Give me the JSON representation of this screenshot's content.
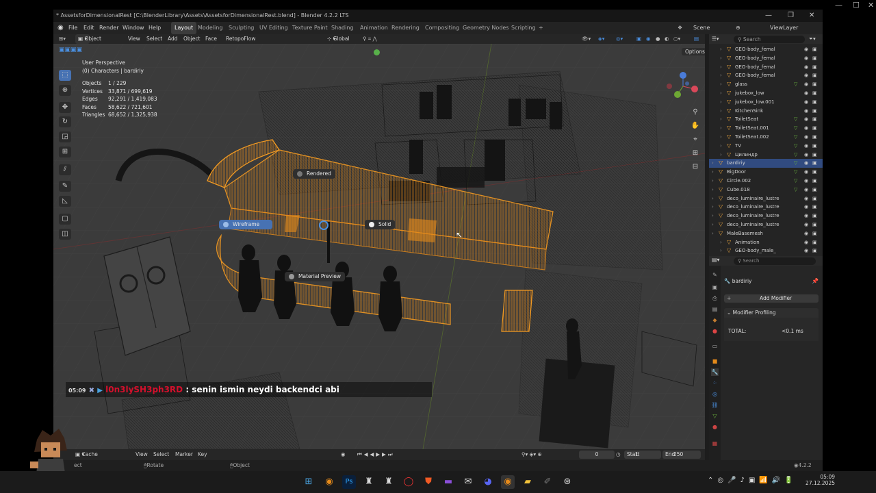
{
  "window": {
    "title": "* AssetsforDimensionalRest [C:\\BlenderLibrary\\Assets\\AssetsforDimensionalRest.blend] - Blender 4.2.2 LTS"
  },
  "menu": {
    "items": [
      "File",
      "Edit",
      "Render",
      "Window",
      "Help"
    ],
    "workspaces": [
      "Layout",
      "Modeling",
      "Sculpting",
      "UV Editing",
      "Texture Paint",
      "Shading",
      "Animation",
      "Rendering",
      "Compositing",
      "Geometry Nodes",
      "Scripting"
    ],
    "add_tab": "+",
    "scene": "Scene",
    "view_layer": "ViewLayer"
  },
  "viewport_header": {
    "mode": "Object Mode",
    "items": [
      "View",
      "Select",
      "Add",
      "Object",
      "Face",
      "RetopoFlow"
    ],
    "orientation": "Global",
    "options": "Options"
  },
  "overlay": {
    "perspective": "User Perspective",
    "collection": "(0) Characters | bardiriy",
    "stats": [
      {
        "k": "Objects",
        "v": "1 / 229"
      },
      {
        "k": "Vertices",
        "v": "33,871 / 699,619"
      },
      {
        "k": "Edges",
        "v": "92,291 / 1,419,083"
      },
      {
        "k": "Faces",
        "v": "58,622 / 721,601"
      },
      {
        "k": "Triangles",
        "v": "68,652 / 1,325,938"
      }
    ]
  },
  "pie": {
    "rendered": "Rendered",
    "wireframe": "Wireframe",
    "solid": "Solid",
    "material": "Material Preview"
  },
  "chat": {
    "time": "05:09",
    "user": "l0n3lySH3ph3RD",
    "sep": " : ",
    "message": "senin ismin neydi backendci abi"
  },
  "timeline": {
    "items": [
      "Cache File",
      "View",
      "Select",
      "Marker",
      "Key"
    ],
    "frame": "0",
    "start_label": "Start",
    "start": "1",
    "end_label": "End",
    "end": "250"
  },
  "status": {
    "left": "ect",
    "middle": "Rotate View",
    "right": "Object",
    "version": "4.2.2"
  },
  "outliner": {
    "search": "Search",
    "rows": [
      {
        "name": "GEO-body_femal",
        "ind": 1,
        "mat": false
      },
      {
        "name": "GEO-body_femal",
        "ind": 1,
        "mat": false
      },
      {
        "name": "GEO-body_femal",
        "ind": 1,
        "mat": false
      },
      {
        "name": "GEO-body_femal",
        "ind": 1,
        "mat": false
      },
      {
        "name": "glass",
        "ind": 1,
        "mat": true
      },
      {
        "name": "jukebox_low",
        "ind": 1,
        "mat": false
      },
      {
        "name": "jukebox_low.001",
        "ind": 1,
        "mat": false
      },
      {
        "name": "KitchenSink",
        "ind": 1,
        "mat": false
      },
      {
        "name": "ToiletSeat",
        "ind": 1,
        "mat": true
      },
      {
        "name": "ToiletSeat.001",
        "ind": 1,
        "mat": true
      },
      {
        "name": "ToiletSeat.002",
        "ind": 1,
        "mat": true
      },
      {
        "name": "TV",
        "ind": 1,
        "mat": true
      },
      {
        "name": "Цилиндр",
        "ind": 1,
        "mat": true
      },
      {
        "name": "bardiriy",
        "ind": 0,
        "mat": true,
        "sel": true
      },
      {
        "name": "BigDoor",
        "ind": 0,
        "mat": true
      },
      {
        "name": "Circle.002",
        "ind": 0,
        "mat": true
      },
      {
        "name": "Cube.018",
        "ind": 0,
        "mat": true
      },
      {
        "name": "deco_luminaire_lustre",
        "ind": 0,
        "mat": false
      },
      {
        "name": "deco_luminaire_lustre",
        "ind": 0,
        "mat": false
      },
      {
        "name": "deco_luminaire_lustre",
        "ind": 0,
        "mat": false
      },
      {
        "name": "deco_luminaire_lustre",
        "ind": 0,
        "mat": false
      },
      {
        "name": "MaleBasemesh",
        "ind": 0,
        "mat": false
      },
      {
        "name": "Animation",
        "ind": 1,
        "mat": false
      },
      {
        "name": "GEO-body_male_",
        "ind": 1,
        "mat": false
      }
    ]
  },
  "properties": {
    "search": "Search",
    "object": "bardiriy",
    "add_modifier": "Add Modifier",
    "profiling": "Modifier Profiling",
    "total_label": "TOTAL:",
    "total_value": "<0.1 ms"
  },
  "taskbar": {
    "time": "05:09",
    "date": "27.12.2025"
  }
}
